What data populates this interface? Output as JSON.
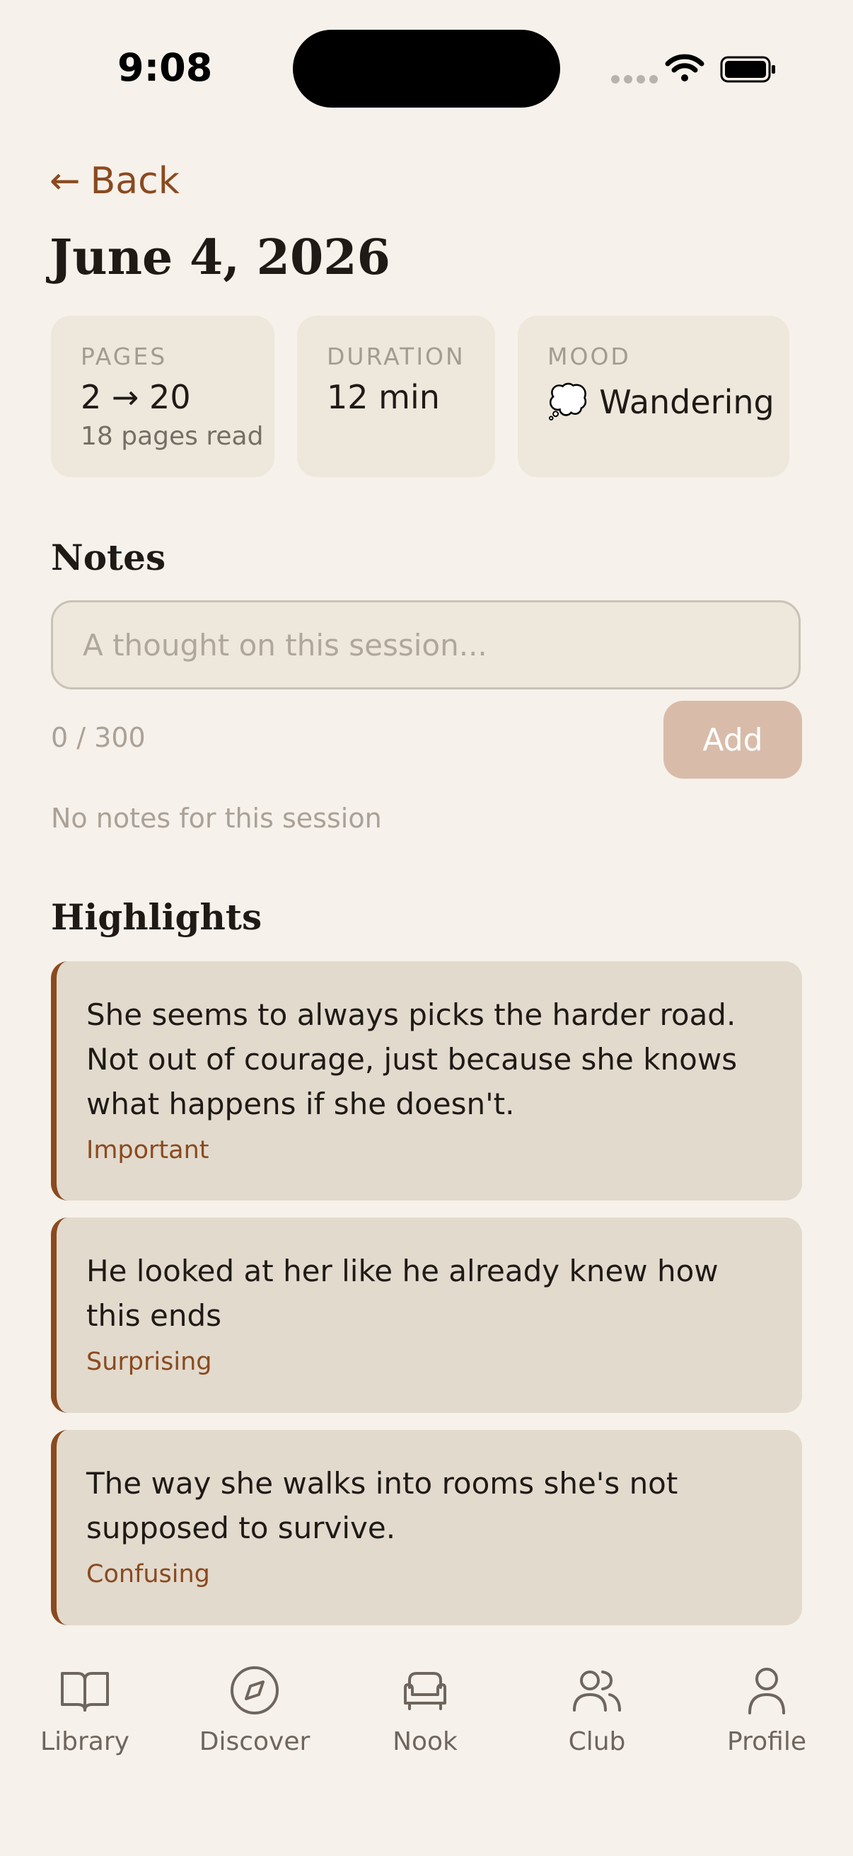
{
  "status": {
    "time": "9:08"
  },
  "back_label": "Back",
  "title": "June 4, 2026",
  "stats": {
    "pages": {
      "label": "PAGES",
      "value": "2 → 20",
      "sub": "18 pages read"
    },
    "duration": {
      "label": "DURATION",
      "value": "12 min"
    },
    "mood": {
      "label": "MOOD",
      "emoji": "💭",
      "value": "Wandering"
    }
  },
  "notes": {
    "heading": "Notes",
    "placeholder": "A thought on this session...",
    "counter": "0 / 300",
    "add_label": "Add",
    "empty": "No notes for this session"
  },
  "highlights": {
    "heading": "Highlights",
    "items": [
      {
        "quote": "She seems to always picks the harder road. Not out of courage, just because she knows what happens if she doesn't.",
        "tag": "Important"
      },
      {
        "quote": "He looked at her like he already knew how this ends",
        "tag": "Surprising"
      },
      {
        "quote": "The way she walks into rooms she's not supposed to survive.",
        "tag": "Confusing"
      }
    ]
  },
  "nav": [
    {
      "label": "Library",
      "icon": "book-icon"
    },
    {
      "label": "Discover",
      "icon": "compass-icon"
    },
    {
      "label": "Nook",
      "icon": "armchair-icon"
    },
    {
      "label": "Club",
      "icon": "users-icon"
    },
    {
      "label": "Profile",
      "icon": "user-icon"
    }
  ],
  "colors": {
    "accent": "#8a4a1f",
    "background": "#f6f1ea",
    "card": "#ede7dc",
    "highlight": "#e2dacd"
  }
}
